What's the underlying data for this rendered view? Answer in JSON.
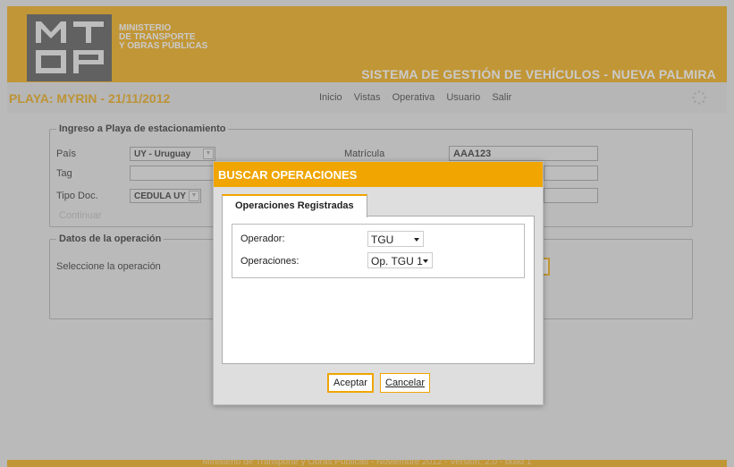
{
  "colors": {
    "accent": "#f0a500",
    "playa_title": "#e8a000",
    "background": "#e4e4e4"
  },
  "header": {
    "logo_letters": "MTOP",
    "ministry_lines": [
      "MINISTERIO",
      "DE TRANSPORTE",
      "Y OBRAS PÚBLICAS"
    ],
    "system_title": "SISTEMA DE GESTIÓN DE VEHÍCULOS - NUEVA PALMIRA"
  },
  "nav": {
    "playa_title": "PLAYA: MYRIN - 21/11/2012",
    "menu": [
      "Inicio",
      "Vistas",
      "Operativa",
      "Usuario",
      "Salir"
    ],
    "spinner_icon": "loading-spinner-icon"
  },
  "ingreso": {
    "legend": "Ingreso a Playa de estacionamiento",
    "pais_label": "País",
    "pais_value": "UY - Uruguay",
    "matricula_label": "Matrícula",
    "matricula_value": "AAA123",
    "tag_label": "Tag",
    "tag_value": "",
    "tipo_doc_label": "Tipo Doc.",
    "tipo_doc_value": "CEDULA UY",
    "continuar_label": "Continuar"
  },
  "operacion": {
    "legend": "Datos de la operación",
    "seleccione_label": "Seleccione la operación"
  },
  "footer": {
    "text": "Ministerio de Transporte y Obras Públicas - Noviembre 2012 - Versión: 2.0 - build 1"
  },
  "modal": {
    "title": "BUSCAR OPERACIONES",
    "tab_label": "Operaciones Registradas",
    "operador_label": "Operador:",
    "operador_value": "TGU",
    "operaciones_label": "Operaciones:",
    "operaciones_value": "Op. TGU 1",
    "aceptar_label": "Aceptar",
    "cancelar_label": "Cancelar"
  }
}
